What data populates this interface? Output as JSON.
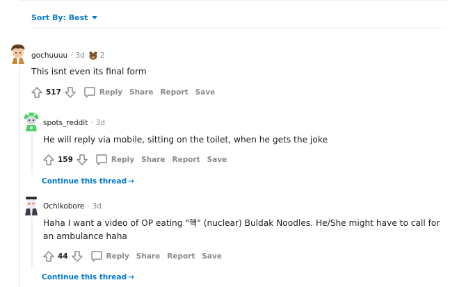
{
  "sort": {
    "label": "Sort By: Best"
  },
  "comments": [
    {
      "username": "gochuuuu",
      "separator": "·",
      "time": "3d",
      "award_count": "2",
      "text": "This isnt even its final form",
      "votes": "517",
      "actions": {
        "reply": "Reply",
        "share": "Share",
        "report": "Report",
        "save": "Save"
      }
    },
    {
      "username": "spots_reddit",
      "separator": "·",
      "time": "3d",
      "text": "He will reply via mobile, sitting on the toilet, when he gets the joke",
      "votes": "159",
      "actions": {
        "reply": "Reply",
        "share": "Share",
        "report": "Report",
        "save": "Save"
      },
      "continue_label": "Continue this thread"
    },
    {
      "username": "Ochikobore",
      "separator": "·",
      "time": "3d",
      "text": "Haha I want a video of OP eating \"핵\" (nuclear) Buldak Noodles. He/She might have to call for an ambulance haha",
      "votes": "44",
      "actions": {
        "reply": "Reply",
        "share": "Share",
        "report": "Report",
        "save": "Save"
      },
      "continue_label": "Continue this thread"
    }
  ],
  "colors": {
    "accent": "#0079d3",
    "muted": "#878a8c",
    "text": "#1c1c1c",
    "rule": "#edeff1"
  }
}
